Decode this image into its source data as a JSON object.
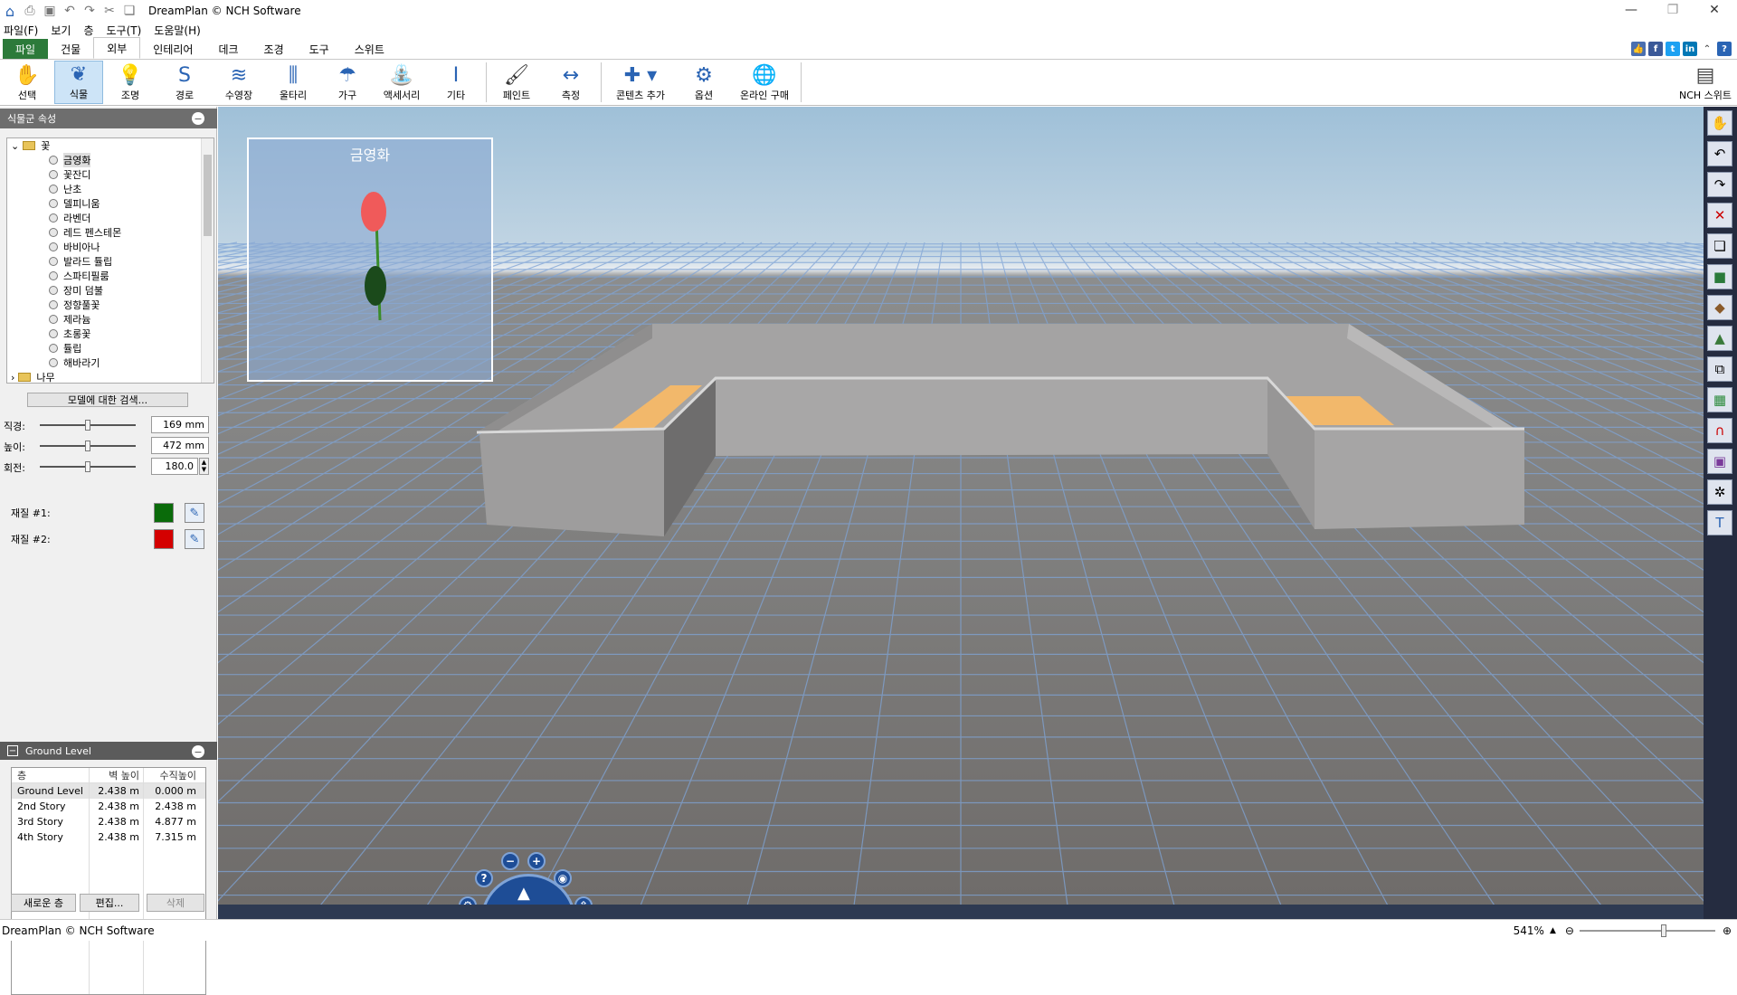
{
  "window": {
    "title": "DreamPlan © NCH Software",
    "minimize": "—",
    "restore": "❐",
    "close": "✕"
  },
  "quick_access": [
    "save-icon",
    "print-icon",
    "undo-icon",
    "redo-icon",
    "cut-icon",
    "copy-icon"
  ],
  "menu": [
    "파일(F)",
    "보기",
    "층",
    "도구(T)",
    "도움말(H)"
  ],
  "ribbon_tabs": [
    "파일",
    "건물",
    "외부",
    "인테리어",
    "데크",
    "조경",
    "도구",
    "스위트"
  ],
  "toolbar": {
    "items": [
      "선택",
      "식물",
      "조명",
      "경로",
      "수영장",
      "울타리",
      "가구",
      "액세서리",
      "기타",
      "페인트",
      "측정",
      "콘텐츠 추가",
      "옵션",
      "온라인 구매"
    ],
    "right_item": "NCH 스위트"
  },
  "plant_panel": {
    "header": "식물군 속성",
    "folder_flowers": "꽃",
    "plants": [
      "금영화",
      "꽃잔디",
      "난초",
      "델피니움",
      "라벤더",
      "레드 펜스테몬",
      "바비아나",
      "발라드 튤립",
      "스파티필룸",
      "장미 덤불",
      "정향풀꽃",
      "제라늄",
      "초롱꽃",
      "튤립",
      "해바라기"
    ],
    "folder_trees": "나무",
    "search_button": "모델에 대한 검색...",
    "diameter_label": "직경:",
    "diameter_value": "169 mm",
    "height_label": "높이:",
    "height_value": "472 mm",
    "rotation_label": "회전:",
    "rotation_value": "180.0",
    "material1_label": "재질 #1:",
    "material1_color": "#0a6b0a",
    "material2_label": "재질 #2:",
    "material2_color": "#d40000"
  },
  "levels_panel": {
    "header": "Ground Level",
    "columns": [
      "층",
      "벽 높이",
      "수직높이"
    ],
    "rows": [
      [
        "Ground Level",
        "2.438 m",
        "0.000 m"
      ],
      [
        "2nd Story",
        "2.438 m",
        "2.438 m"
      ],
      [
        "3rd Story",
        "2.438 m",
        "4.877 m"
      ],
      [
        "4th Story",
        "2.438 m",
        "7.315 m"
      ]
    ],
    "new_button": "새로운 층",
    "edit_button": "편집...",
    "delete_button": "삭제"
  },
  "preview": {
    "title": "금영화"
  },
  "status": {
    "text": "DreamPlan © NCH Software",
    "zoom": "541%"
  }
}
